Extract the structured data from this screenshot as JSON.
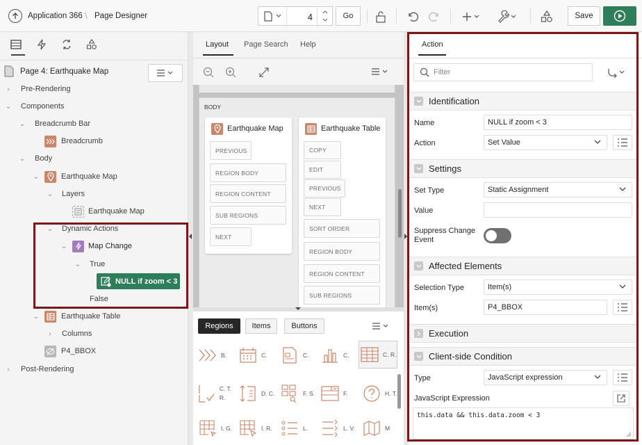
{
  "app": {
    "name": "Application 366",
    "section": "Page Designer",
    "page_number": "4",
    "go_label": "Go",
    "save_label": "Save"
  },
  "left": {
    "page_title": "Page 4: Earthquake Map",
    "tree": {
      "pre_rendering": "Pre-Rendering",
      "components": "Components",
      "breadcrumb_bar": "Breadcrumb Bar",
      "breadcrumb": "Breadcrumb",
      "body": "Body",
      "earthquake_map": "Earthquake Map",
      "layers": "Layers",
      "layer_earthquake_map": "Earthquake Map",
      "dynamic_actions": "Dynamic Actions",
      "map_change": "Map Change",
      "true_label": "True",
      "action_null": "NULL if zoom < 3",
      "false_label": "False",
      "earthquake_table": "Earthquake Table",
      "columns": "Columns",
      "p4_bbox": "P4_BBOX",
      "post_rendering": "Post-Rendering"
    }
  },
  "middle": {
    "tabs": [
      "Layout",
      "Page Search",
      "Help"
    ],
    "body_label": "BODY",
    "map_card": {
      "title": "Earthquake Map",
      "slots": [
        "PREVIOUS",
        "REGION BODY",
        "REGION CONTENT",
        "SUB REGIONS",
        "NEXT"
      ]
    },
    "table_card": {
      "title": "Earthquake Table",
      "slots": [
        "COPY",
        "EDIT",
        "PREVIOUS",
        "NEXT",
        "SORT ORDER",
        "REGION BODY",
        "REGION CONTENT",
        "SUB REGIONS"
      ]
    },
    "gallery_tabs": [
      "Regions",
      "Items",
      "Buttons"
    ],
    "gallery": [
      [
        "B.",
        "C.",
        "C.",
        "C."
      ],
      [
        "C. T. R.",
        "D. C.",
        "F. S.",
        "F."
      ],
      [
        "I. G.",
        "I. R.",
        "L.",
        "L. V."
      ]
    ],
    "gallery_selected": "C. R.",
    "gallery_extra": [
      "H. T.",
      "M"
    ]
  },
  "right": {
    "tab": "Action",
    "filter_placeholder": "Filter",
    "sections": {
      "identification": "Identification",
      "settings": "Settings",
      "affected": "Affected Elements",
      "execution": "Execution",
      "condition": "Client-side Condition"
    },
    "props": {
      "name_label": "Name",
      "name_value": "NULL if zoom < 3",
      "action_label": "Action",
      "action_value": "Set Value",
      "set_type_label": "Set Type",
      "set_type_value": "Static Assignment",
      "value_label": "Value",
      "value_value": "",
      "suppress_label": "Suppress Change Event",
      "suppress_on": false,
      "selection_type_label": "Selection Type",
      "selection_type_value": "Item(s)",
      "items_label": "Item(s)",
      "items_value": "P4_BBOX",
      "cond_type_label": "Type",
      "cond_type_value": "JavaScript expression",
      "js_expr_label": "JavaScript Expression",
      "js_expr_value": "this.data && this.data.zoom < 3"
    }
  },
  "colors": {
    "accent_green": "#2e7d5b",
    "highlight_red": "#7b1517",
    "region_icon": "#c8876b",
    "da_icon": "#a27dbd"
  }
}
